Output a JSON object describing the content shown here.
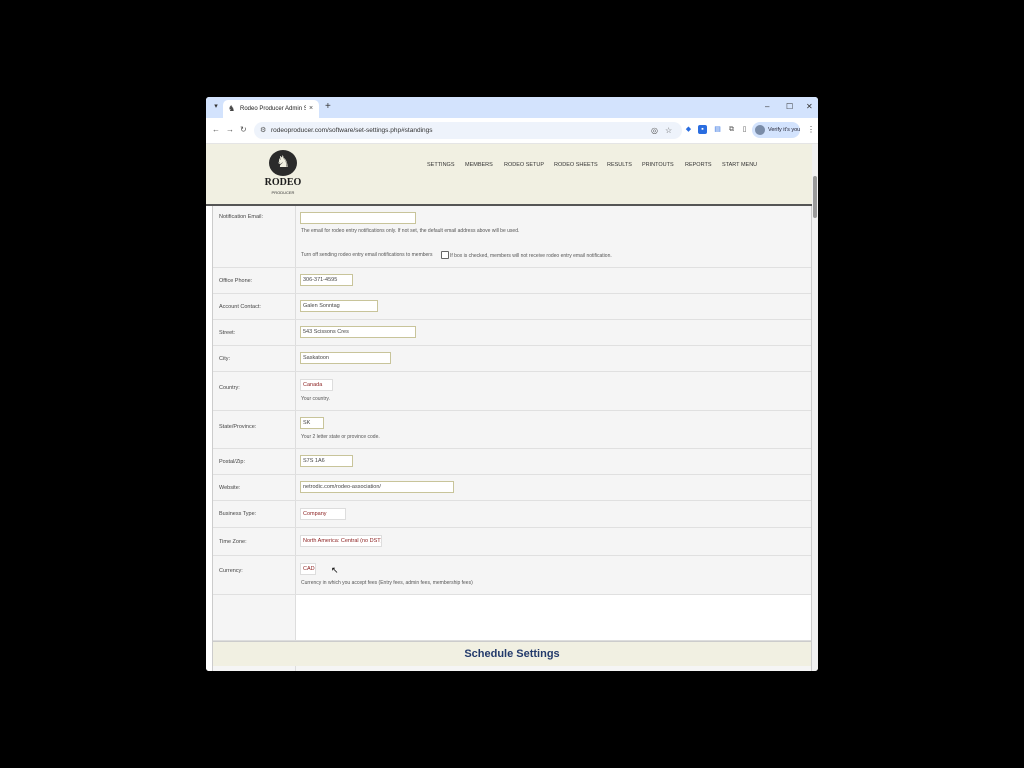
{
  "browser": {
    "tab_title": "Rodeo Producer Admin Setting",
    "tab_close": "×",
    "new_tab": "+",
    "url": "rodeoproducer.com/software/set-settings.php#standings",
    "profile_label": "Verify it's you",
    "minimize": "–",
    "maximize": "☐",
    "close": "✕"
  },
  "site": {
    "logo_text": "RODEO",
    "logo_sub": "PRODUCER",
    "nav": [
      "SETTINGS",
      "MEMBERS",
      "RODEO SETUP",
      "RODEO SHEETS",
      "RESULTS",
      "PRINTOUTS",
      "REPORTS",
      "START MENU"
    ]
  },
  "form": {
    "notification_email": {
      "label": "Notification Email:",
      "value": "",
      "help": "The email for rodeo entry notifications only. If not set, the default email address above will be used.",
      "toggle_text": "Turn off sending rodeo entry email notifications to members",
      "toggle_help": "If box is checked, members will not receive rodeo entry email notification."
    },
    "office_phone": {
      "label": "Office Phone:",
      "value": "306-371-4595"
    },
    "account_contact": {
      "label": "Account Contact:",
      "value": "Galen Sonntag"
    },
    "street": {
      "label": "Street:",
      "value": "543 Scissons Cres"
    },
    "city": {
      "label": "City:",
      "value": "Saskatoon"
    },
    "country": {
      "label": "Country:",
      "value": "Canada",
      "help": "Your country."
    },
    "state": {
      "label": "State/Province:",
      "value": "SK",
      "help": "Your 2 letter state or province code."
    },
    "postal": {
      "label": "Postal/Zip:",
      "value": "S7S 1A6"
    },
    "website": {
      "label": "Website:",
      "value": "netrodic.com/rodeo-association/"
    },
    "business_type": {
      "label": "Business Type:",
      "value": "Company"
    },
    "time_zone": {
      "label": "Time Zone:",
      "value": "North America: Central (no DST)"
    },
    "currency": {
      "label": "Currency:",
      "value": "CAD",
      "help": "Currency in which you accept fees (Entry fees, admin fees, membership fees)"
    }
  },
  "schedule": {
    "title": "Schedule Settings"
  }
}
